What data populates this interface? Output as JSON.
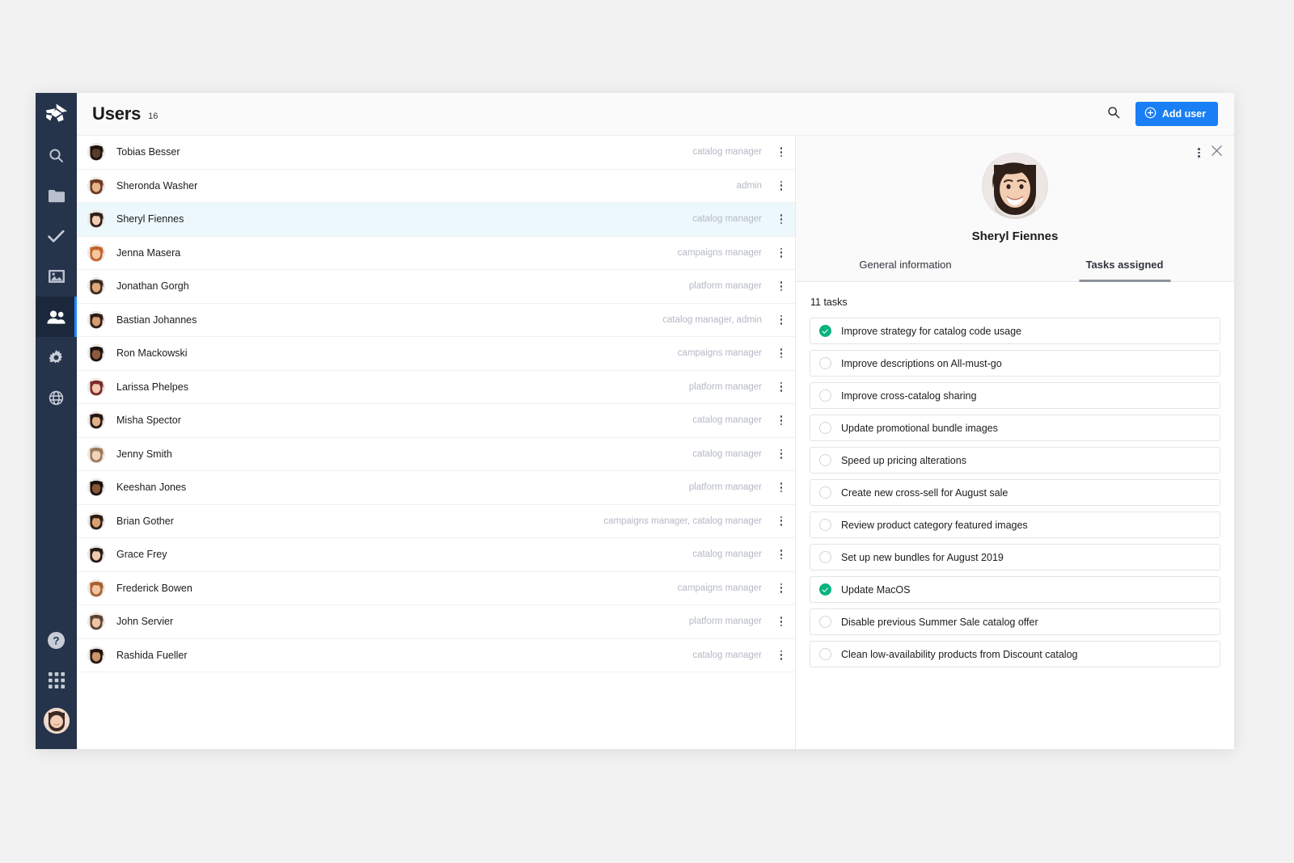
{
  "sidebar": {
    "logo_name": "app-logo",
    "items": [
      {
        "icon": "search-icon",
        "name": "sidebar-item-search",
        "active": false
      },
      {
        "icon": "folder-icon",
        "name": "sidebar-item-files",
        "active": false
      },
      {
        "icon": "check-icon",
        "name": "sidebar-item-tasks",
        "active": false
      },
      {
        "icon": "image-icon",
        "name": "sidebar-item-media",
        "active": false
      },
      {
        "icon": "users-icon",
        "name": "sidebar-item-users",
        "active": true
      },
      {
        "icon": "gear-icon",
        "name": "sidebar-item-settings",
        "active": false
      },
      {
        "icon": "globe-icon",
        "name": "sidebar-item-global",
        "active": false
      }
    ],
    "bottom_items": [
      {
        "icon": "help-icon",
        "name": "sidebar-item-help"
      },
      {
        "icon": "grid-apps-icon",
        "name": "sidebar-item-apps"
      },
      {
        "icon": "avatar",
        "name": "sidebar-current-user-avatar"
      }
    ]
  },
  "topbar": {
    "title": "Users",
    "count": "16",
    "search_icon": "search-icon",
    "add_user_label": "Add user",
    "add_user_icon": "plus-circle-icon",
    "accent_color": "#1a7ef5"
  },
  "user_list": [
    {
      "name": "Tobias Besser",
      "role": "catalog manager",
      "selected": false
    },
    {
      "name": "Sheronda Washer",
      "role": "admin",
      "selected": false
    },
    {
      "name": "Sheryl Fiennes",
      "role": "catalog manager",
      "selected": true
    },
    {
      "name": "Jenna Masera",
      "role": "campaigns manager",
      "selected": false
    },
    {
      "name": "Jonathan Gorgh",
      "role": "platform manager",
      "selected": false
    },
    {
      "name": "Bastian Johannes",
      "role": "catalog manager, admin",
      "selected": false
    },
    {
      "name": "Ron Mackowski",
      "role": "campaigns manager",
      "selected": false
    },
    {
      "name": "Larissa Phelpes",
      "role": "platform manager",
      "selected": false
    },
    {
      "name": "Misha Spector",
      "role": "catalog manager",
      "selected": false
    },
    {
      "name": "Jenny Smith",
      "role": "catalog manager",
      "selected": false
    },
    {
      "name": "Keeshan Jones",
      "role": "platform manager",
      "selected": false
    },
    {
      "name": "Brian Gother",
      "role": "campaigns manager, catalog manager",
      "selected": false
    },
    {
      "name": "Grace Frey",
      "role": "catalog manager",
      "selected": false
    },
    {
      "name": "Frederick Bowen",
      "role": "campaigns manager",
      "selected": false
    },
    {
      "name": "John Servier",
      "role": "platform manager",
      "selected": false
    },
    {
      "name": "Rashida Fueller",
      "role": "catalog manager",
      "selected": false
    }
  ],
  "detail": {
    "user_name": "Sheryl Fiennes",
    "kebab_icon": "kebab-menu-icon",
    "close_icon": "close-icon",
    "tabs": [
      {
        "label": "General information",
        "active": false
      },
      {
        "label": "Tasks assigned",
        "active": true
      }
    ],
    "task_count_label": "11 tasks",
    "done_color": "#08b27f",
    "tasks": [
      {
        "label": "Improve strategy for catalog code usage",
        "done": true
      },
      {
        "label": "Improve descriptions on All-must-go",
        "done": false
      },
      {
        "label": "Improve cross-catalog sharing",
        "done": false
      },
      {
        "label": "Update promotional bundle images",
        "done": false
      },
      {
        "label": "Speed up pricing alterations",
        "done": false
      },
      {
        "label": "Create new cross-sell for August sale",
        "done": false
      },
      {
        "label": "Review product category featured images",
        "done": false
      },
      {
        "label": "Set up new bundles for August 2019",
        "done": false
      },
      {
        "label": "Update MacOS",
        "done": true
      },
      {
        "label": "Disable previous Summer Sale catalog offer",
        "done": false
      },
      {
        "label": "Clean low-availability products from Discount catalog",
        "done": false
      }
    ]
  }
}
